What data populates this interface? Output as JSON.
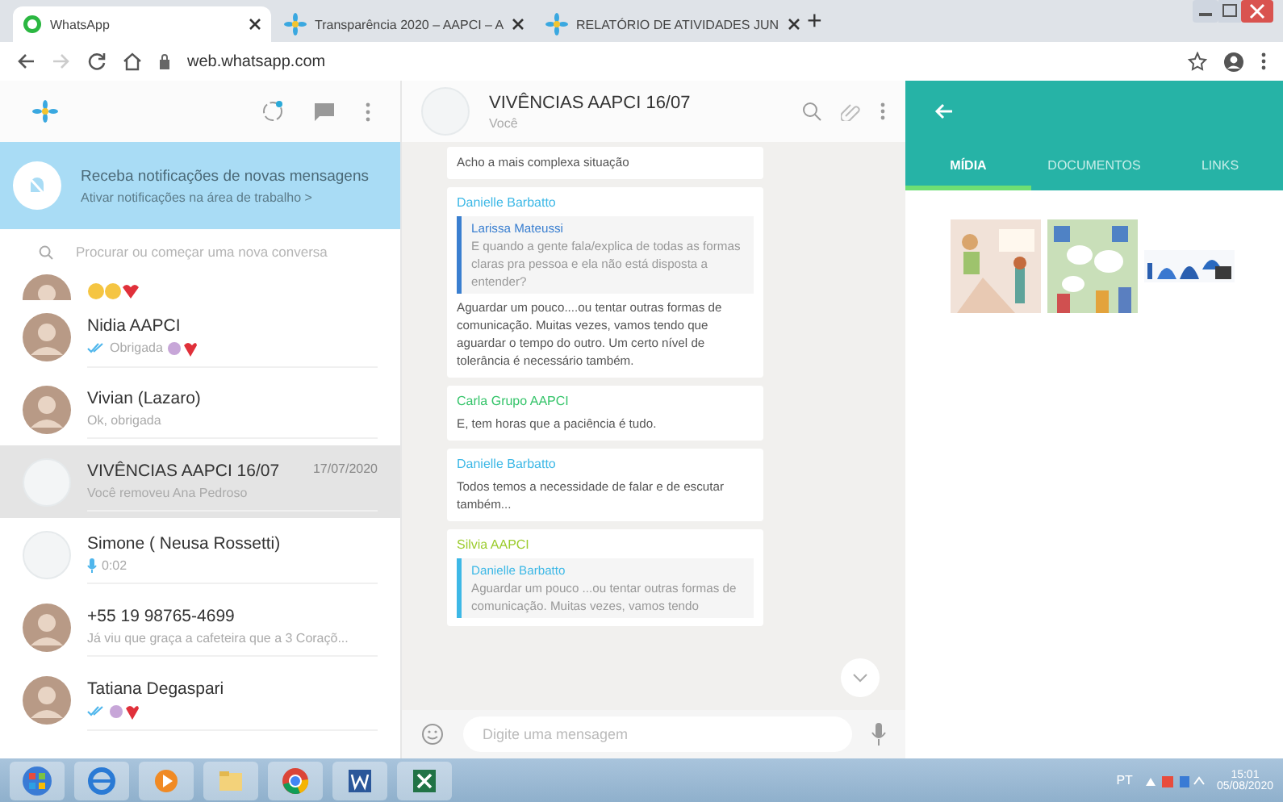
{
  "browser": {
    "tabs": [
      {
        "title": "WhatsApp",
        "selected": true
      },
      {
        "title": "Transparência 2020 – AAPCI – A",
        "selected": false
      },
      {
        "title": "RELATÓRIO DE ATIVIDADES JUN",
        "selected": false
      }
    ],
    "new_tab": "+",
    "url": "web.whatsapp.com"
  },
  "sidebar": {
    "notification": {
      "title": "Receba notificações de novas mensagens",
      "link": "Ativar notificações na área de trabalho >"
    },
    "search": {
      "placeholder": "Procurar ou começar uma nova conversa"
    },
    "chats": [
      {
        "kind": "partial",
        "selected": false
      },
      {
        "name": "Nidia AAPCI",
        "preview": "Obrigada",
        "ticks": true,
        "selected": false
      },
      {
        "name": "Vivian (Lazaro)",
        "preview": "Ok, obrigada",
        "ticks": false,
        "selected": false
      },
      {
        "kind": "plain",
        "name": "VIVÊNCIAS AAPCI 16/07",
        "time": "17/07/2020",
        "preview": "Você removeu Ana Pedroso",
        "ticks": false,
        "selected": true
      },
      {
        "kind": "plain",
        "name": "Simone ( Neusa Rossetti)",
        "preview": "0:02",
        "voice": true,
        "ticks": false,
        "selected": false
      },
      {
        "name": "+55 19 98765-4699",
        "preview": "Já viu que graça a cafeteira que a 3 Coraçõ...",
        "ticks": false,
        "selected": false
      },
      {
        "name": "Tatiana Degaspari",
        "ticks": true,
        "selected": false
      }
    ]
  },
  "chat": {
    "title": "VIVÊNCIAS AAPCI 16/07",
    "subtitle": "Você",
    "messages": [
      {
        "text": "Acho a mais complexa situação"
      },
      {
        "sender": "Danielle Barbatto",
        "color": "#3db8e6",
        "quote": {
          "sender": "Larissa Mateussi",
          "color": "#3a7fd0",
          "text": "E quando a gente fala/explica de todas as formas claras pra pessoa e ela não está disposta a entender?"
        },
        "text": "Aguardar um pouco....ou tentar outras formas de comunicação. Muitas vezes, vamos tendo que aguardar o tempo do outro. Um certo nível de tolerância é necessário também."
      },
      {
        "sender": "Carla Grupo AAPCI",
        "color": "#35c46a",
        "text": "E, tem horas que a paciência é tudo."
      },
      {
        "sender": "Danielle Barbatto",
        "color": "#3db8e6",
        "text": "Todos temos a necessidade de falar e de escutar também..."
      },
      {
        "sender": "Silvia AAPCI",
        "color": "#9ccc2e",
        "quote": {
          "sender": "Danielle Barbatto",
          "color": "#3db8e6",
          "text": "Aguardar um pouco ...ou tentar outras formas de comunicação. Muitas vezes, vamos tendo"
        }
      }
    ],
    "input": {
      "placeholder": "Digite uma mensagem"
    }
  },
  "media_panel": {
    "tabs": [
      {
        "label": "MÍDIA",
        "selected": true
      },
      {
        "label": "DOCUMENTOS",
        "selected": false
      },
      {
        "label": "LINKS",
        "selected": false
      }
    ]
  },
  "taskbar": {
    "apps": [
      {
        "kind": "start"
      },
      {
        "kind": "ie"
      },
      {
        "kind": "media"
      },
      {
        "kind": "files"
      },
      {
        "kind": "chrome"
      },
      {
        "kind": "word"
      },
      {
        "kind": "excel"
      }
    ],
    "language": "PT",
    "time": "15:01",
    "date": "05/08/2020"
  }
}
